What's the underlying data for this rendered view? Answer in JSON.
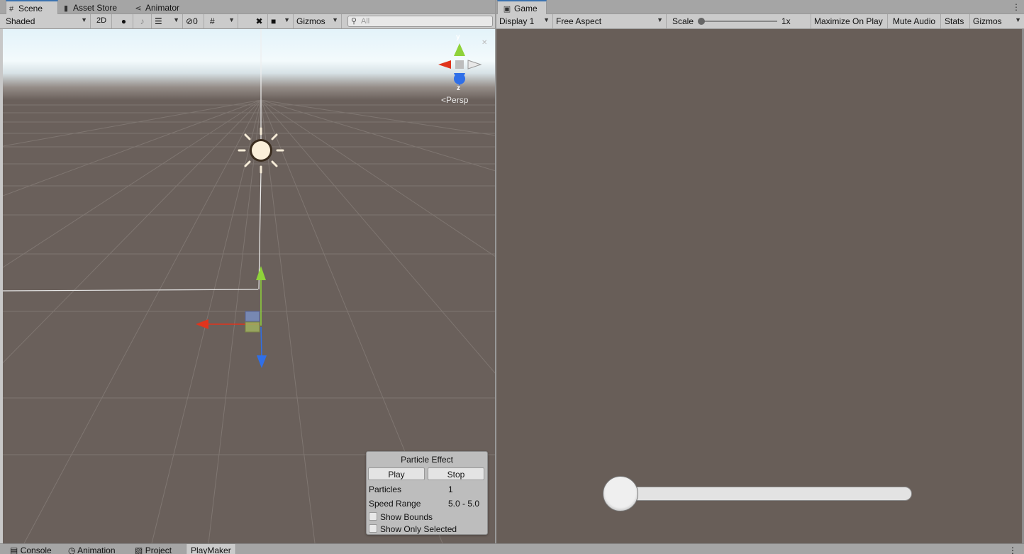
{
  "scene_window": {
    "tabs": [
      {
        "label": "Scene",
        "icon": "grid-icon"
      },
      {
        "label": "Asset Store",
        "icon": "bag-icon"
      },
      {
        "label": "Animator",
        "icon": "animator-icon"
      }
    ],
    "toolbar": {
      "draw_mode": "Shaded",
      "mode_2d": "2D",
      "hidden_count": "0",
      "gizmos": "Gizmos",
      "search_placeholder": "All"
    },
    "orientation": {
      "axis_y": "y",
      "axis_z": "z",
      "projection": "Persp"
    },
    "particle_effect": {
      "title": "Particle Effect",
      "play": "Play",
      "stop": "Stop",
      "particles_label": "Particles",
      "particles_value": "1",
      "speed_label": "Speed Range",
      "speed_value": "5.0 - 5.0",
      "show_bounds": "Show Bounds",
      "show_only_selected": "Show Only Selected"
    }
  },
  "game_window": {
    "tab": {
      "label": "Game",
      "icon": "gamepad-icon"
    },
    "toolbar": {
      "display": "Display 1",
      "aspect": "Free Aspect",
      "scale_label": "Scale",
      "scale_value": "1x",
      "maximize": "Maximize On Play",
      "mute": "Mute Audio",
      "stats": "Stats",
      "gizmos": "Gizmos"
    },
    "slider_value_fraction": 0.0
  },
  "bottom_tabs": [
    {
      "label": "Console",
      "icon": "console-icon"
    },
    {
      "label": "Animation",
      "icon": "clock-icon"
    },
    {
      "label": "Project",
      "icon": "folder-icon"
    },
    {
      "label": "PlayMaker",
      "active": true
    }
  ],
  "colors": {
    "accent": "#3a72b0",
    "axis_x": "#e0341c",
    "axis_y": "#8fd23a",
    "axis_z": "#2f6fe8",
    "ground": "#6a605b",
    "game_bg": "#685e58"
  }
}
